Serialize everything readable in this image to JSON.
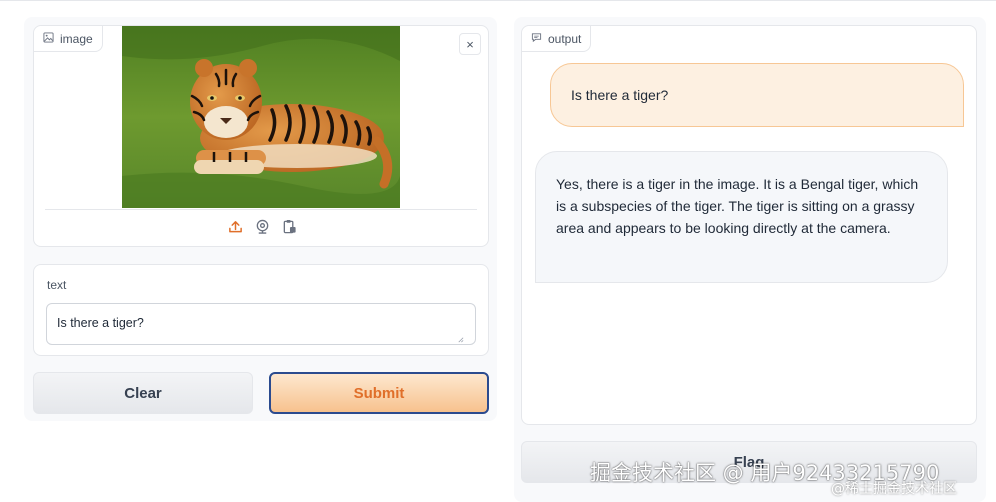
{
  "image_panel": {
    "label": "image",
    "icons": {
      "label_icon": "image-icon",
      "close": "close-icon",
      "upload": "upload-icon",
      "webcam": "webcam-icon",
      "clipboard": "clipboard-icon"
    },
    "close_glyph": "×"
  },
  "text_panel": {
    "label": "text",
    "value": "Is there a tiger?"
  },
  "buttons": {
    "clear": "Clear",
    "submit": "Submit",
    "flag": "Flag"
  },
  "output_panel": {
    "label": "output",
    "label_icon": "chat-icon",
    "messages": [
      {
        "role": "user",
        "text": "Is there a tiger?"
      },
      {
        "role": "bot",
        "text": "Yes, there is a tiger in the image. It is a Bengal tiger, which is a subspecies of the tiger. The tiger is sitting on a grassy area and appears to be looking directly at the camera."
      }
    ]
  },
  "watermark": {
    "main": "掘金技术社区 @ 用户92433215790",
    "sub": "@稀土掘金技术社区"
  },
  "colors": {
    "accent_orange": "#e06f2a",
    "submit_border": "#2b4b8f",
    "user_bubble": "#fdf0e1",
    "bot_bubble": "#f5f7fa"
  }
}
